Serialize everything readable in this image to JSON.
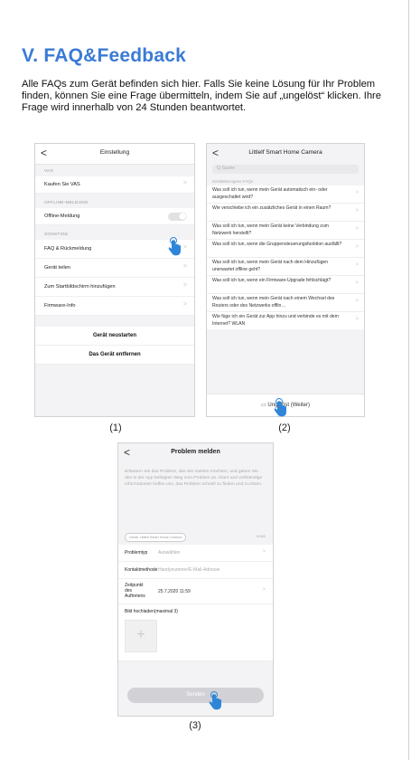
{
  "heading": "V. FAQ&Feedback",
  "intro": "Alle FAQs zum Gerät befinden sich hier. Falls Sie keine Lösung für Ihr Problem finden, können Sie eine Frage übermitteln, indem Sie auf „ungelöst“ klicken. Ihre Frage wird innerhalb von 24 Stunden beantwortet.",
  "captions": [
    "(1)",
    "(2)",
    "(3)"
  ],
  "colors": {
    "heading": "#3a7bd5",
    "hand": "#2f86d8"
  },
  "screen1": {
    "back": "<",
    "title": "Einstellung",
    "sec_vas": "VAS",
    "buy_vas": "Kaufen Sie VAS",
    "sec_offline": "OFFLINE-MELDUNG",
    "offline_label": "Offline-Meldung",
    "sec_other": "SONSTIGE",
    "faq": "FAQ & Rückmeldung",
    "share": "Gerät teilen",
    "home": "Zum Startbildschirm hinzufügen",
    "firmware": "Firmware-Info",
    "restart": "Gerät neustarten",
    "remove": "Das Gerät entfernen",
    "chevron": ">"
  },
  "screen2": {
    "back": "<",
    "title": "Littlelf Smart Home Camera",
    "search_placeholder": "Q Suche",
    "faq_header": "Gerätebezogene FAQs",
    "faqs": [
      "Was soll ich tun, wenn mein Gerät automatisch ein- oder ausgeschaltet wird?",
      "Wie verschiebe ich ein zusätzliches Gerät in einen Raum?",
      "Was soll ich tun, wenn mein Gerät keine Verbindung zum Netzwerk herstellt?",
      "Was soll ich tun, wenn die Gruppensteuerungsfunktion ausfällt?",
      "Was soll ich tun, wenn mein Gerät nach dem Hinzufügen unerwartet offline geht?",
      "Was soll ich tun, wenn ein Firmware-Upgrade fehlschlägt?",
      "Was soll ich tun, wenn mein Gerät nach einem Wechsel des Routers oder des Netzwerks offlin…",
      "Wie füge ich ein Gerät zur App hinzu und verbinde es mit dem Internet? WLAN"
    ],
    "unsolved": "Ungelöst (Weiter)",
    "chevron": ">"
  },
  "screen3": {
    "back": "<",
    "title": "Problem melden",
    "description": "Erläutern Sie das Problem, das Sie melden möchten, und geben Sie den in der App befolgten Weg zum Problem an. Klare und vollständige Informationen helfen uns, das Problem schnell zu finden und zu lösen.",
    "device_tag": "Gerät: Littlelf Smart Home Camera",
    "counter": "0/300",
    "problem_type_label": "Problemtyp",
    "problem_type_value": "Auswählen",
    "contact_label": "Kontaktmethode",
    "contact_value": "Handynummer/E-Mail-Adresse",
    "time_label": "Zeitpunkt des Auftretens",
    "time_value": "25.7.2020 11:59",
    "upload_label": "Bild hochladen(maximal 3)",
    "upload_plus": "+",
    "send": "Senden",
    "chevron": ">"
  }
}
